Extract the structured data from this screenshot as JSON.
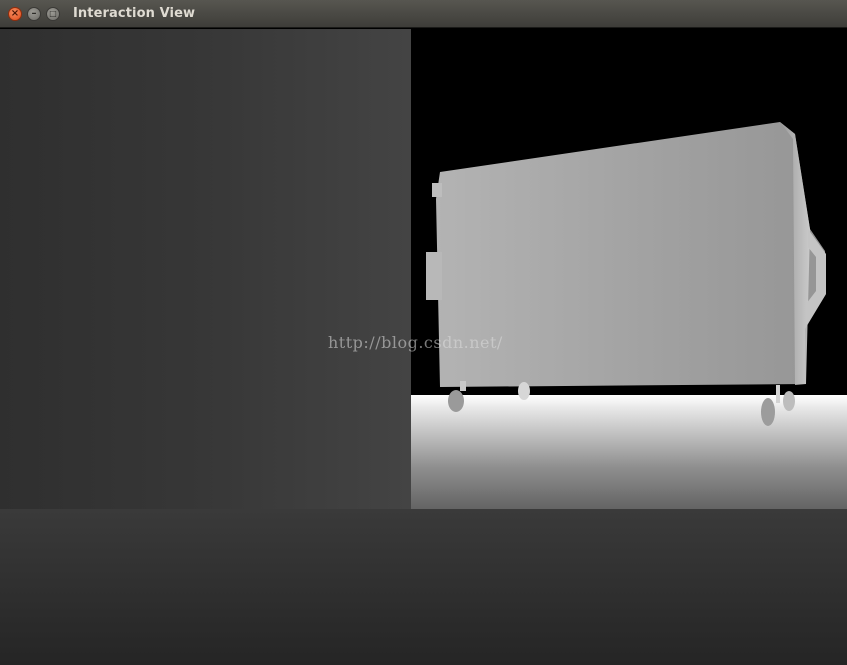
{
  "window": {
    "title": "Interaction View",
    "close_glyph": "×",
    "minimize_glyph": "–",
    "maximize_glyph": "□"
  },
  "watermark": {
    "text": "http://blog.csdn.net/"
  },
  "colors": {
    "close_button": "#e04d1b",
    "titlebar": "#4a4945"
  },
  "icons": {
    "close": "close-icon",
    "minimize": "minimize-icon",
    "maximize": "maximize-icon"
  }
}
